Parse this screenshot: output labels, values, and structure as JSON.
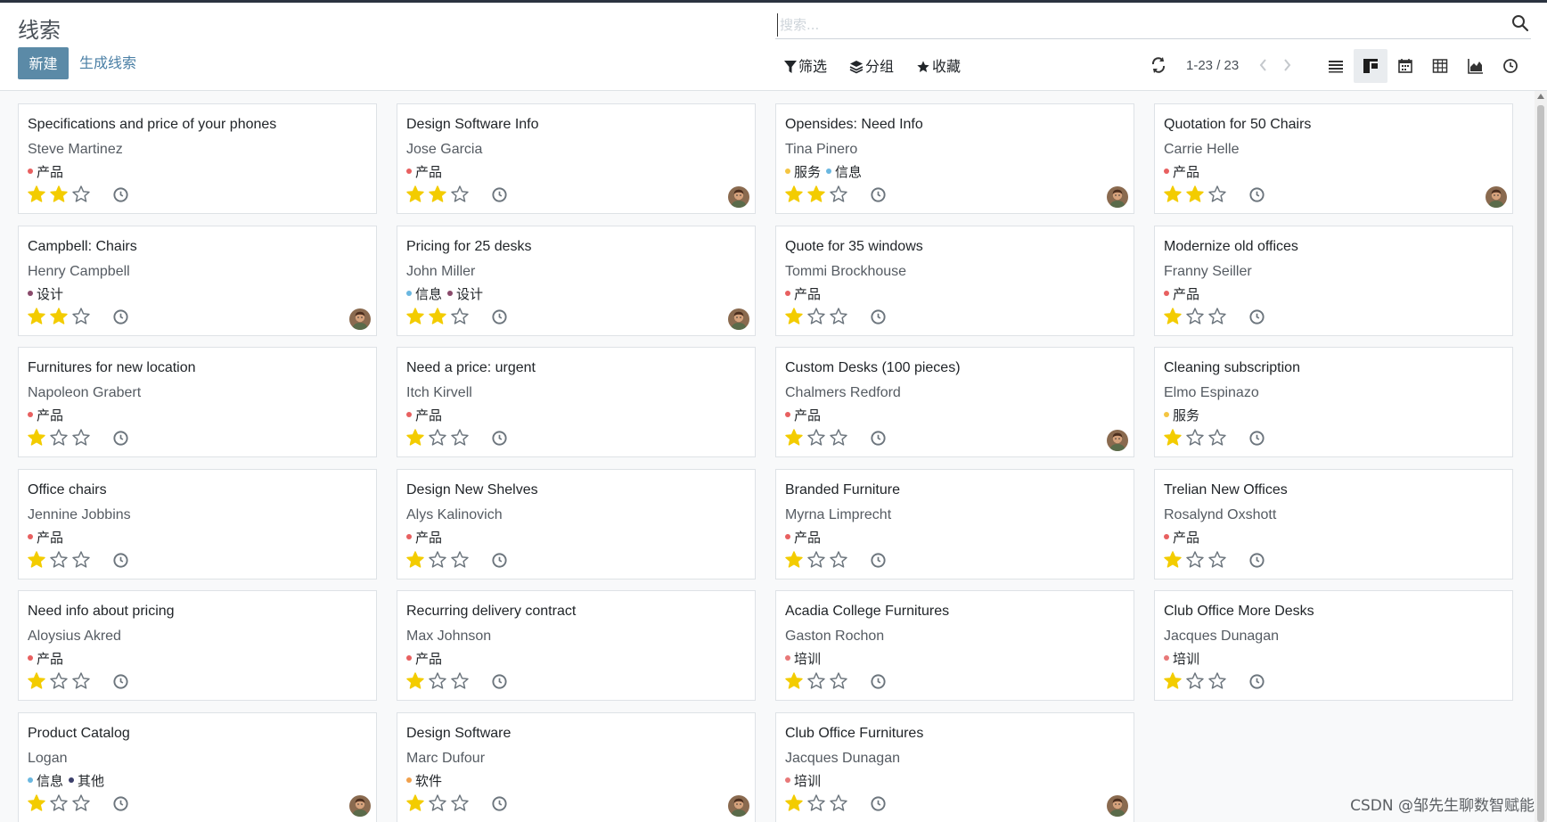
{
  "app": {
    "breadcrumb": "线索",
    "new_label": "新建",
    "generate_label": "生成线索",
    "search_placeholder": "搜索..."
  },
  "filters": {
    "filter_label": "筛选",
    "group_label": "分组",
    "favorites_label": "收藏"
  },
  "pager": {
    "value": "1-23 / 23"
  },
  "views": [
    "list-icon",
    "kanban-icon",
    "calendar-icon",
    "pivot-icon",
    "graph-icon",
    "activity-icon"
  ],
  "active_view": "kanban-icon",
  "tag_colors": {
    "产品": "#e86060",
    "服务": "#f4c542",
    "信息": "#6ab7e0",
    "设计": "#8a4a6b",
    "培训": "#e87878",
    "软件": "#f0a04b",
    "其他": "#3b3f6b"
  },
  "star_color": "#f3cc00",
  "cards": [
    {
      "title": "Specifications and price of your phones",
      "contact": "Steve Martinez",
      "tags": [
        "产品"
      ],
      "stars": 2,
      "avatar": false
    },
    {
      "title": "Design Software Info",
      "contact": "Jose Garcia",
      "tags": [
        "产品"
      ],
      "stars": 2,
      "avatar": true
    },
    {
      "title": "Opensides: Need Info",
      "contact": "Tina Pinero",
      "tags": [
        "服务",
        "信息"
      ],
      "stars": 2,
      "avatar": true
    },
    {
      "title": "Quotation for 50 Chairs",
      "contact": "Carrie Helle",
      "tags": [
        "产品"
      ],
      "stars": 2,
      "avatar": true
    },
    {
      "title": "Campbell: Chairs",
      "contact": "Henry Campbell",
      "tags": [
        "设计"
      ],
      "stars": 2,
      "avatar": true
    },
    {
      "title": "Pricing for 25 desks",
      "contact": "John Miller",
      "tags": [
        "信息",
        "设计"
      ],
      "stars": 2,
      "avatar": true
    },
    {
      "title": "Quote for 35 windows",
      "contact": "Tommi Brockhouse",
      "tags": [
        "产品"
      ],
      "stars": 1,
      "avatar": false
    },
    {
      "title": "Modernize old offices",
      "contact": "Franny Seiller",
      "tags": [
        "产品"
      ],
      "stars": 1,
      "avatar": false
    },
    {
      "title": "Furnitures for new location",
      "contact": "Napoleon Grabert",
      "tags": [
        "产品"
      ],
      "stars": 1,
      "avatar": false
    },
    {
      "title": "Need a price: urgent",
      "contact": "Itch Kirvell",
      "tags": [
        "产品"
      ],
      "stars": 1,
      "avatar": false
    },
    {
      "title": "Custom Desks (100 pieces)",
      "contact": "Chalmers Redford",
      "tags": [
        "产品"
      ],
      "stars": 1,
      "avatar": true
    },
    {
      "title": "Cleaning subscription",
      "contact": "Elmo Espinazo",
      "tags": [
        "服务"
      ],
      "stars": 1,
      "avatar": false
    },
    {
      "title": "Office chairs",
      "contact": "Jennine Jobbins",
      "tags": [
        "产品"
      ],
      "stars": 1,
      "avatar": false
    },
    {
      "title": "Design New Shelves",
      "contact": "Alys Kalinovich",
      "tags": [
        "产品"
      ],
      "stars": 1,
      "avatar": false
    },
    {
      "title": "Branded Furniture",
      "contact": "Myrna Limprecht",
      "tags": [
        "产品"
      ],
      "stars": 1,
      "avatar": false
    },
    {
      "title": "Trelian New Offices",
      "contact": "Rosalynd Oxshott",
      "tags": [
        "产品"
      ],
      "stars": 1,
      "avatar": false
    },
    {
      "title": "Need info about pricing",
      "contact": "Aloysius Akred",
      "tags": [
        "产品"
      ],
      "stars": 1,
      "avatar": false
    },
    {
      "title": "Recurring delivery contract",
      "contact": "Max Johnson",
      "tags": [
        "产品"
      ],
      "stars": 1,
      "avatar": false
    },
    {
      "title": "Acadia College Furnitures",
      "contact": "Gaston Rochon",
      "tags": [
        "培训"
      ],
      "stars": 1,
      "avatar": false
    },
    {
      "title": "Club Office More Desks",
      "contact": "Jacques Dunagan",
      "tags": [
        "培训"
      ],
      "stars": 1,
      "avatar": false
    },
    {
      "title": "Product Catalog",
      "contact": "Logan",
      "tags": [
        "信息",
        "其他"
      ],
      "stars": 1,
      "avatar": true
    },
    {
      "title": "Design Software",
      "contact": "Marc Dufour",
      "tags": [
        "软件"
      ],
      "stars": 1,
      "avatar": true
    },
    {
      "title": "Club Office Furnitures",
      "contact": "Jacques Dunagan",
      "tags": [
        "培训"
      ],
      "stars": 1,
      "avatar": true
    }
  ],
  "watermark": "CSDN @邹先生聊数智赋能"
}
